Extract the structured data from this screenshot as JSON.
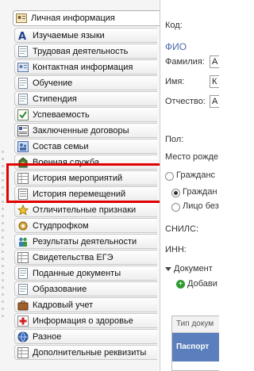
{
  "tabs": [
    {
      "label": "Личная информация",
      "icon": "person-card-icon"
    },
    {
      "label": "Изучаемые языки",
      "icon": "letter-a-icon"
    },
    {
      "label": "Трудовая деятельность",
      "icon": "document-icon"
    },
    {
      "label": "Контактная информация",
      "icon": "contact-card-icon"
    },
    {
      "label": "Обучение",
      "icon": "document-icon"
    },
    {
      "label": "Стипендия",
      "icon": "document-icon"
    },
    {
      "label": "Успеваемость",
      "icon": "grades-icon"
    },
    {
      "label": "Заключенные договоры",
      "icon": "contract-icon"
    },
    {
      "label": "Состав семьи",
      "icon": "family-icon"
    },
    {
      "label": "Военная служба",
      "icon": "military-icon"
    },
    {
      "label": "История мероприятий",
      "icon": "table-icon"
    },
    {
      "label": "История перемещений",
      "icon": "list-icon"
    },
    {
      "label": "Отличительные признаки",
      "icon": "star-icon"
    },
    {
      "label": "Студпрофком",
      "icon": "gear-icon"
    },
    {
      "label": "Результаты деятельности",
      "icon": "people-icon"
    },
    {
      "label": "Свидетельства ЕГЭ",
      "icon": "table-icon"
    },
    {
      "label": "Поданные документы",
      "icon": "document-icon"
    },
    {
      "label": "Образование",
      "icon": "document-icon"
    },
    {
      "label": "Кадровый учет",
      "icon": "briefcase-icon"
    },
    {
      "label": "Информация о здоровье",
      "icon": "health-icon"
    },
    {
      "label": "Разное",
      "icon": "globe-icon"
    },
    {
      "label": "Дополнительные реквизиты",
      "icon": "table-icon"
    }
  ],
  "form": {
    "code_label": "Код:",
    "fio_label": "ФИО",
    "surname_label": "Фамилия:",
    "name_label": "Имя:",
    "patronymic_label": "Отчество:",
    "surname_value": "А",
    "name_value": "К",
    "patronymic_value": "А",
    "gender_label": "Пол:",
    "birthplace_label": "Место рожде",
    "citizenship_label": "Гражданс",
    "citizenship_option1": "Граждан",
    "citizenship_option2": "Лицо без",
    "snils_label": "СНИЛС:",
    "inn_label": "ИНН:",
    "documents_label": "Документ",
    "add_button": "Добави",
    "doc_type_header": "Тип докум",
    "doc_row": "Паспорт"
  },
  "colors": {
    "accent_blue": "#4a6aa8",
    "highlight_red": "#e00000",
    "selected_row": "#5b7fbd",
    "add_green": "#2e9a2e"
  }
}
